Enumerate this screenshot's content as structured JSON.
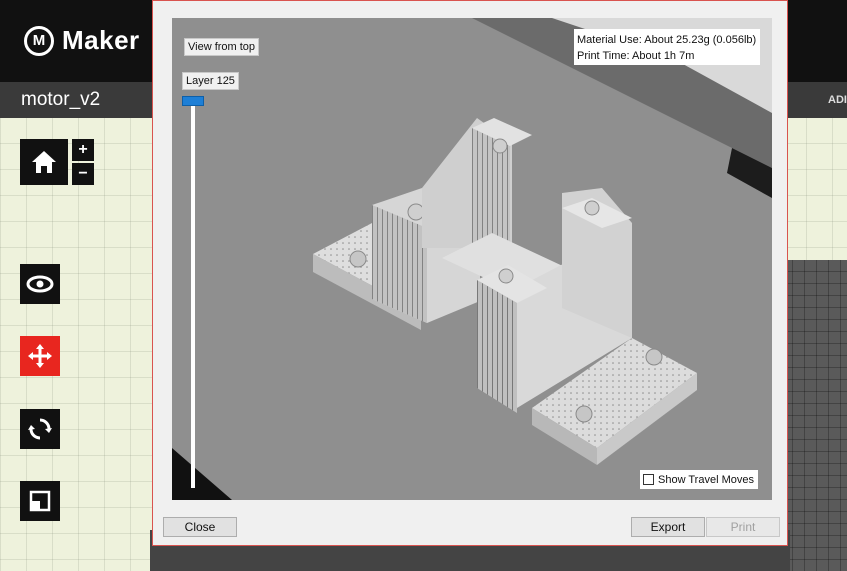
{
  "app": {
    "brand": "Maker",
    "brand_letter": "M",
    "file_name": "motor_v2",
    "header_right": "ADI"
  },
  "sidebar": {
    "home_glyph": "⌂",
    "zoom_in": "+",
    "zoom_out": "−",
    "tools": [
      {
        "name": "view-icon",
        "glyph": "👁"
      },
      {
        "name": "move-icon",
        "glyph": "✥"
      },
      {
        "name": "rotate-icon",
        "glyph": "⟳"
      },
      {
        "name": "scale-icon",
        "glyph": "◰"
      }
    ],
    "accent_active": "#e8261f"
  },
  "preview_dialog": {
    "view_from_top": "View from top",
    "layer_label": "Layer 125",
    "material_use": "Material Use: About 25.23g (0.056lb)",
    "print_time": "Print Time: About 1h 7m",
    "show_travel_moves": "Show Travel Moves",
    "show_travel_moves_checked": false,
    "close_label": "Close",
    "export_label": "Export",
    "print_label": "Print",
    "print_enabled": false
  },
  "colors": {
    "slider_thumb": "#1e7fd6",
    "viewport_bg": "#8f8f8f",
    "dialog_border": "#d9534f"
  }
}
